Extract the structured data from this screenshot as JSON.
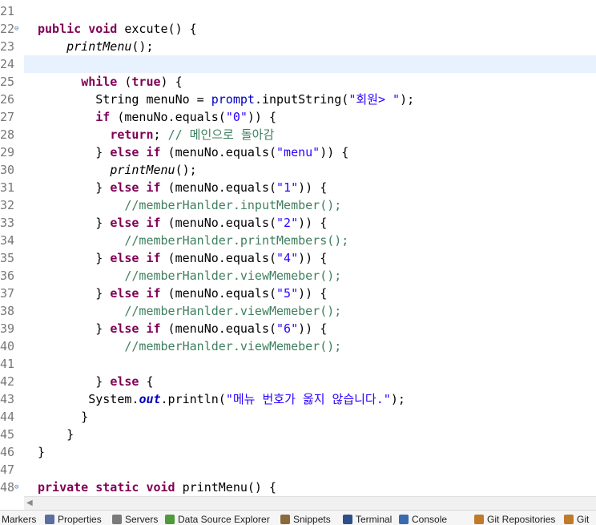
{
  "editor": {
    "lines": [
      {
        "n": "21",
        "fold": false,
        "current": false,
        "tokens": []
      },
      {
        "n": "22",
        "fold": true,
        "current": false,
        "tokens": [
          [
            "kw",
            "public"
          ],
          [
            "p",
            " "
          ],
          [
            "kw",
            "void"
          ],
          [
            "p",
            " excute() {"
          ]
        ]
      },
      {
        "n": "23",
        "fold": false,
        "current": false,
        "tokens": [
          [
            "p",
            "    "
          ],
          [
            "ital",
            "printMenu"
          ],
          [
            "p",
            "();"
          ]
        ]
      },
      {
        "n": "24",
        "fold": false,
        "current": true,
        "tokens": []
      },
      {
        "n": "25",
        "fold": false,
        "current": false,
        "tokens": [
          [
            "p",
            "      "
          ],
          [
            "kw",
            "while"
          ],
          [
            "p",
            " ("
          ],
          [
            "kw",
            "true"
          ],
          [
            "p",
            ") {"
          ]
        ]
      },
      {
        "n": "26",
        "fold": false,
        "current": false,
        "tokens": [
          [
            "p",
            "        String "
          ],
          [
            "p",
            "menuNo = "
          ],
          [
            "fld",
            "prompt"
          ],
          [
            "p",
            ".inputString("
          ],
          [
            "str",
            "\"회원> \""
          ],
          [
            "p",
            ");"
          ]
        ]
      },
      {
        "n": "27",
        "fold": false,
        "current": false,
        "tokens": [
          [
            "p",
            "        "
          ],
          [
            "kw",
            "if"
          ],
          [
            "p",
            " (menuNo.equals("
          ],
          [
            "str",
            "\"0\""
          ],
          [
            "p",
            ")) {"
          ]
        ]
      },
      {
        "n": "28",
        "fold": false,
        "current": false,
        "tokens": [
          [
            "p",
            "          "
          ],
          [
            "kw",
            "return"
          ],
          [
            "p",
            "; "
          ],
          [
            "cmt",
            "// 메인으로 돌아감"
          ]
        ]
      },
      {
        "n": "29",
        "fold": false,
        "current": false,
        "tokens": [
          [
            "p",
            "        } "
          ],
          [
            "kw",
            "else"
          ],
          [
            "p",
            " "
          ],
          [
            "kw",
            "if"
          ],
          [
            "p",
            " (menuNo.equals("
          ],
          [
            "str",
            "\"menu\""
          ],
          [
            "p",
            ")) {"
          ]
        ]
      },
      {
        "n": "30",
        "fold": false,
        "current": false,
        "tokens": [
          [
            "p",
            "          "
          ],
          [
            "ital",
            "printMenu"
          ],
          [
            "p",
            "();"
          ]
        ]
      },
      {
        "n": "31",
        "fold": false,
        "current": false,
        "tokens": [
          [
            "p",
            "        } "
          ],
          [
            "kw",
            "else"
          ],
          [
            "p",
            " "
          ],
          [
            "kw",
            "if"
          ],
          [
            "p",
            " (menuNo.equals("
          ],
          [
            "str",
            "\"1\""
          ],
          [
            "p",
            ")) {"
          ]
        ]
      },
      {
        "n": "32",
        "fold": false,
        "current": false,
        "tokens": [
          [
            "p",
            "            "
          ],
          [
            "cmt",
            "//memberHanlder.inputMember();"
          ]
        ]
      },
      {
        "n": "33",
        "fold": false,
        "current": false,
        "tokens": [
          [
            "p",
            "        } "
          ],
          [
            "kw",
            "else"
          ],
          [
            "p",
            " "
          ],
          [
            "kw",
            "if"
          ],
          [
            "p",
            " (menuNo.equals("
          ],
          [
            "str",
            "\"2\""
          ],
          [
            "p",
            ")) {"
          ]
        ]
      },
      {
        "n": "34",
        "fold": false,
        "current": false,
        "tokens": [
          [
            "p",
            "            "
          ],
          [
            "cmt",
            "//memberHanlder.printMembers();"
          ]
        ]
      },
      {
        "n": "35",
        "fold": false,
        "current": false,
        "tokens": [
          [
            "p",
            "        } "
          ],
          [
            "kw",
            "else"
          ],
          [
            "p",
            " "
          ],
          [
            "kw",
            "if"
          ],
          [
            "p",
            " (menuNo.equals("
          ],
          [
            "str",
            "\"4\""
          ],
          [
            "p",
            ")) {"
          ]
        ]
      },
      {
        "n": "36",
        "fold": false,
        "current": false,
        "tokens": [
          [
            "p",
            "            "
          ],
          [
            "cmt",
            "//memberHanlder.viewMemeber();"
          ]
        ]
      },
      {
        "n": "37",
        "fold": false,
        "current": false,
        "tokens": [
          [
            "p",
            "        } "
          ],
          [
            "kw",
            "else"
          ],
          [
            "p",
            " "
          ],
          [
            "kw",
            "if"
          ],
          [
            "p",
            " (menuNo.equals("
          ],
          [
            "str",
            "\"5\""
          ],
          [
            "p",
            ")) {"
          ]
        ]
      },
      {
        "n": "38",
        "fold": false,
        "current": false,
        "tokens": [
          [
            "p",
            "            "
          ],
          [
            "cmt",
            "//memberHanlder.viewMemeber();"
          ]
        ]
      },
      {
        "n": "39",
        "fold": false,
        "current": false,
        "tokens": [
          [
            "p",
            "        } "
          ],
          [
            "kw",
            "else"
          ],
          [
            "p",
            " "
          ],
          [
            "kw",
            "if"
          ],
          [
            "p",
            " (menuNo.equals("
          ],
          [
            "str",
            "\"6\""
          ],
          [
            "p",
            ")) {"
          ]
        ]
      },
      {
        "n": "40",
        "fold": false,
        "current": false,
        "tokens": [
          [
            "p",
            "            "
          ],
          [
            "cmt",
            "//memberHanlder.viewMemeber();"
          ]
        ]
      },
      {
        "n": "41",
        "fold": false,
        "current": false,
        "tokens": []
      },
      {
        "n": "42",
        "fold": false,
        "current": false,
        "tokens": [
          [
            "p",
            "        } "
          ],
          [
            "kw",
            "else"
          ],
          [
            "p",
            " {"
          ]
        ]
      },
      {
        "n": "43",
        "fold": false,
        "current": false,
        "tokens": [
          [
            "p",
            "       System."
          ],
          [
            "fldit",
            "out"
          ],
          [
            "p",
            ".println("
          ],
          [
            "str",
            "\"메뉴 번호가 옳지 않습니다.\""
          ],
          [
            "p",
            ");"
          ]
        ]
      },
      {
        "n": "44",
        "fold": false,
        "current": false,
        "tokens": [
          [
            "p",
            "      }"
          ]
        ]
      },
      {
        "n": "45",
        "fold": false,
        "current": false,
        "tokens": [
          [
            "p",
            "    }"
          ]
        ]
      },
      {
        "n": "46",
        "fold": false,
        "current": false,
        "tokens": [
          [
            "p",
            "}"
          ]
        ]
      },
      {
        "n": "47",
        "fold": false,
        "current": false,
        "tokens": []
      },
      {
        "n": "48",
        "fold": true,
        "current": false,
        "tokens": [
          [
            "kw",
            "private"
          ],
          [
            "p",
            " "
          ],
          [
            "kw",
            "static"
          ],
          [
            "p",
            " "
          ],
          [
            "kw",
            "void"
          ],
          [
            "p",
            " printMenu() {"
          ]
        ]
      }
    ],
    "fold_glyph": "⊖"
  },
  "colors": {
    "keyword": "#7f0055",
    "string": "#2a00ff",
    "comment": "#3f7f5f",
    "field": "#0000c0",
    "current_line": "#e8f2fe"
  },
  "scrollbar": {
    "arrow": "◀"
  },
  "tabs": [
    {
      "label": "Markers",
      "icon": "markers-icon",
      "color": "#6a8bd1"
    },
    {
      "label": "Properties",
      "icon": "properties-icon",
      "color": "#5a6fa0"
    },
    {
      "label": "Servers",
      "icon": "servers-icon",
      "color": "#7a7a7a"
    },
    {
      "label": "Data Source Explorer",
      "icon": "data-source-icon",
      "color": "#4f9a3a"
    },
    {
      "label": "Snippets",
      "icon": "snippets-icon",
      "color": "#8a6a3a"
    },
    {
      "label": "Terminal",
      "icon": "terminal-icon",
      "color": "#2d4f8a"
    },
    {
      "label": "Console",
      "icon": "console-icon",
      "color": "#3a6ab0"
    },
    {
      "label": "Git Repositories",
      "icon": "git-repositories-icon",
      "color": "#c07a2a"
    },
    {
      "label": "Git",
      "icon": "git-icon",
      "color": "#c07a2a"
    }
  ]
}
